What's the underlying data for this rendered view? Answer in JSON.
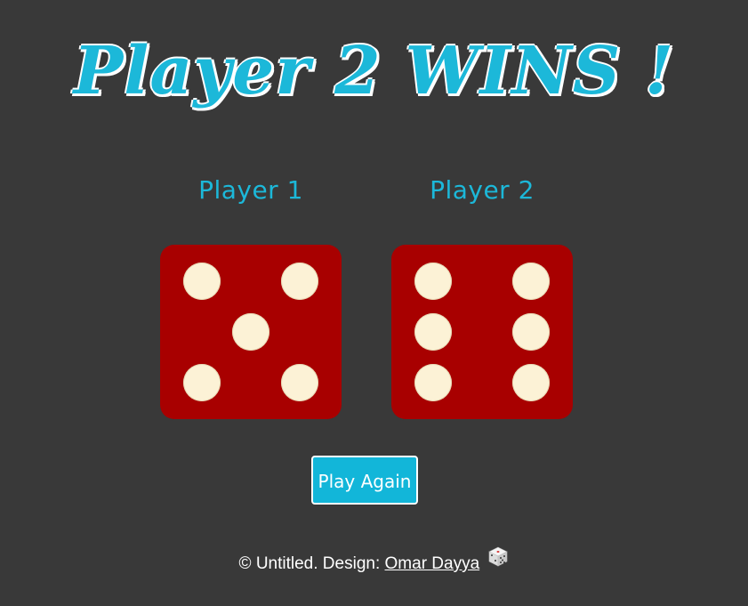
{
  "header": {
    "title": "Player 2 WINS !"
  },
  "players": [
    {
      "label": "Player 1",
      "die_value": 5
    },
    {
      "label": "Player 2",
      "die_value": 6
    }
  ],
  "colors": {
    "background": "#393939",
    "accent": "#1cb8d9",
    "die": "#a80000",
    "pip": "#fcf2d6"
  },
  "actions": {
    "play_again_label": "Play Again"
  },
  "footer": {
    "copyright": "© Untitled. Design: ",
    "designer_link": "Omar Dayya",
    "icon": "dice-icon"
  }
}
